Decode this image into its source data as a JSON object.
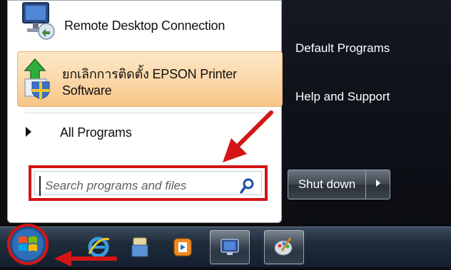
{
  "start_menu": {
    "programs": [
      {
        "label": "Remote Desktop Connection",
        "icon": "remote-desktop-icon"
      },
      {
        "label_line1": "ยกเลิกการติดตั้ง EPSON Printer",
        "label_line2": "Software",
        "icon": "uninstall-icon"
      }
    ],
    "all_programs_label": "All Programs",
    "search": {
      "placeholder": "Search programs and files"
    },
    "right_links": [
      "Default Programs",
      "Help and Support"
    ],
    "shutdown_label": "Shut down"
  },
  "taskbar": {
    "items": [
      "start-orb",
      "internet-explorer-icon",
      "file-explorer-icon",
      "media-player-icon",
      "remote-desktop-taskbar-icon",
      "paint-icon"
    ]
  },
  "annotations": {
    "highlight_color": "#d41515"
  }
}
